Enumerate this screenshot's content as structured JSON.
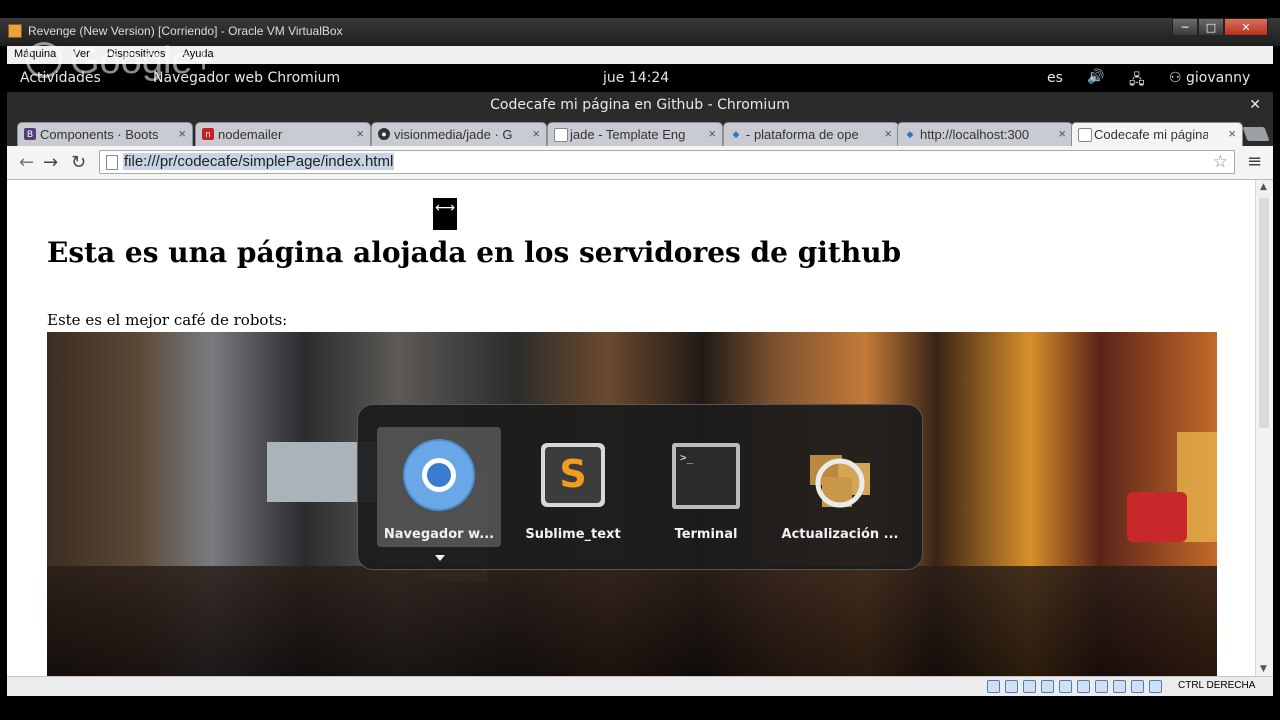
{
  "host": {
    "title": "Revenge (New Version) [Corriendo] - Oracle VM VirtualBox",
    "window_buttons": [
      "─",
      "□",
      "✕"
    ],
    "menu": [
      "Máquina",
      "Ver",
      "Dispositivos",
      "Ayuda"
    ],
    "status_key": "CTRL DERECHA",
    "watermark": "Google+"
  },
  "gnome": {
    "activities": "Actividades",
    "app_menu": "Navegador web Chromium",
    "clock": "jue 14:24",
    "lang": "es",
    "user": "giovanny",
    "volume_icon": "🔊",
    "network_icon": "🖧"
  },
  "chromium": {
    "window_title": "Codecafe mi página en Github - Chromium",
    "close": "✕",
    "tabs": [
      {
        "label": "Components · Boots",
        "fav": "B",
        "fav_color": "#563d7c"
      },
      {
        "label": "nodemailer",
        "fav": "n",
        "fav_color": "#c12127"
      },
      {
        "label": "visionmedia/jade · G",
        "fav": "●",
        "fav_color": "#333333"
      },
      {
        "label": "jade - Template Eng",
        "fav": "",
        "fav_color": "#ffffff"
      },
      {
        "label": "- plataforma de ope",
        "fav": "◆",
        "fav_color": "#2f74c0"
      },
      {
        "label": "http://localhost:300",
        "fav": "◆",
        "fav_color": "#2f74c0"
      },
      {
        "label": "Codecafe mi página",
        "fav": "",
        "fav_color": "#ffffff"
      }
    ],
    "tab_close": "×",
    "url": "file:///pr/codecafe/simplePage/index.html",
    "back": "←",
    "forward": "→",
    "reload": "↻",
    "star": "☆",
    "menu": "≡"
  },
  "page": {
    "heading": "Esta es una página alojada en los servidores de github",
    "paragraph": "Este es el mejor café de robots:"
  },
  "switcher": {
    "items": [
      {
        "name": "Navegador w...",
        "icon": "chromium-icon",
        "selected": true
      },
      {
        "name": "Sublime_text",
        "icon": "sublime-text-icon",
        "selected": false
      },
      {
        "name": "Terminal",
        "icon": "terminal-icon",
        "selected": false
      },
      {
        "name": "Actualización ...",
        "icon": "software-update-icon",
        "selected": false
      }
    ]
  }
}
